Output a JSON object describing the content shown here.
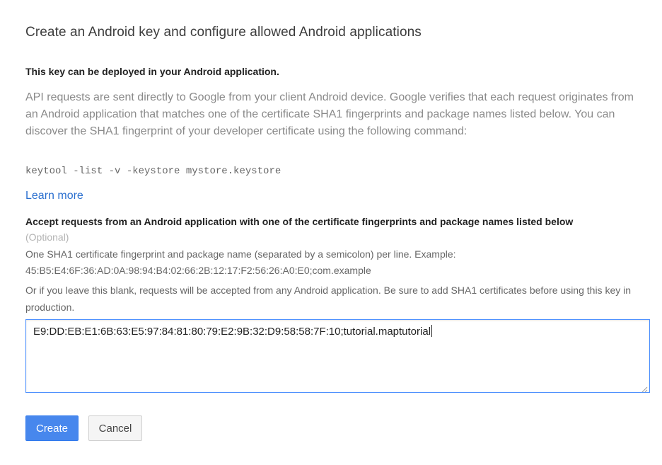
{
  "dialog": {
    "title": "Create an Android key and configure allowed Android applications",
    "subheading": "This key can be deployed in your Android application.",
    "description": "API requests are sent directly to Google from your client Android device. Google verifies that each request originates from an Android application that matches one of the certificate SHA1 fingerprints and package names listed below. You can discover the SHA1 fingerprint of your developer certificate using the following command:",
    "command": "keytool -list -v -keystore mystore.keystore",
    "learn_more": "Learn more"
  },
  "fingerprints": {
    "label": "Accept requests from an Android application with one of the certificate fingerprints and package names listed below",
    "optional": "(Optional)",
    "help_line1": "One SHA1 certificate fingerprint and package name (separated by a semicolon) per line. Example:",
    "help_line2": "45:B5:E4:6F:36:AD:0A:98:94:B4:02:66:2B:12:17:F2:56:26:A0:E0;com.example",
    "help_line3": "Or if you leave this blank, requests will be accepted from any Android application. Be sure to add SHA1 certificates before using this key in production.",
    "value": "E9:DD:EB:E1:6B:63:E5:97:84:81:80:79:E2:9B:32:D9:58:58:7F:10;tutorial.maptutorial"
  },
  "actions": {
    "create_label": "Create",
    "cancel_label": "Cancel"
  },
  "colors": {
    "primary_button": "#4787ed",
    "link": "#2a6fcf",
    "focus_border": "#4d90fe"
  }
}
